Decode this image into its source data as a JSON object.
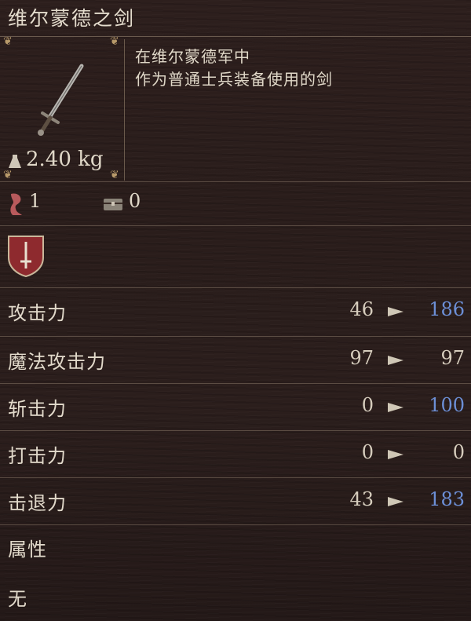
{
  "item": {
    "name": "维尔蒙德之剑",
    "description_line1": "在维尔蒙德军中",
    "description_line2": "作为普通士兵装备使用的剑",
    "weight": "2.40 kg"
  },
  "requirements": {
    "strength_value": "1",
    "chest_value": "0"
  },
  "stats": [
    {
      "label": "攻击力",
      "current": "46",
      "next": "186",
      "next_increased": true
    },
    {
      "label": "魔法攻击力",
      "current": "97",
      "next": "97",
      "next_increased": false
    },
    {
      "label": "斩击力",
      "current": "0",
      "next": "100",
      "next_increased": true
    },
    {
      "label": "打击力",
      "current": "0",
      "next": "0",
      "next_increased": false
    },
    {
      "label": "击退力",
      "current": "43",
      "next": "183",
      "next_increased": true
    }
  ],
  "attribute": {
    "label": "属性",
    "value": "无"
  },
  "colors": {
    "increase": "#6c8fd6",
    "text": "#e2dacb",
    "emblem": "#8e2a2e"
  },
  "icons": {
    "weapon": "sword-icon",
    "weight": "weight-icon",
    "strength": "strength-icon",
    "chest": "chest-icon",
    "emblem": "sword-emblem-icon",
    "arrow": "arrow-right-icon"
  }
}
